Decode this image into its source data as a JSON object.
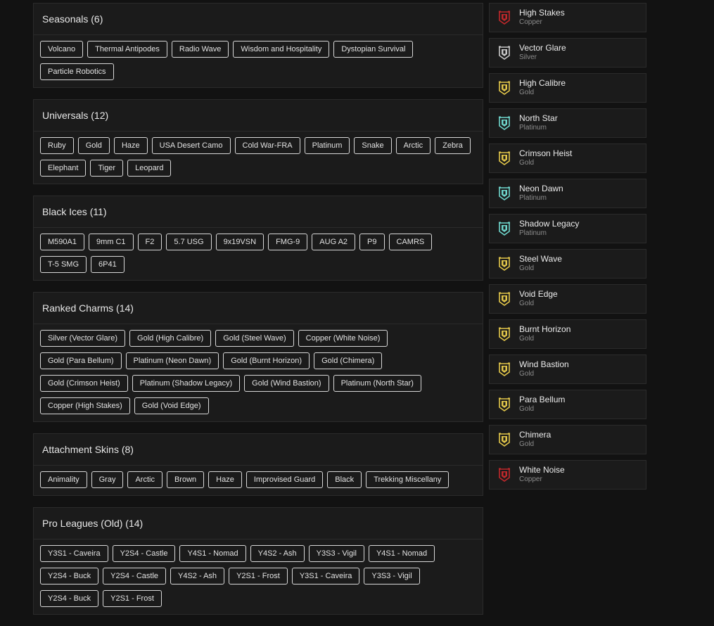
{
  "sections": [
    {
      "title": "Seasonals (6)",
      "items": [
        "Volcano",
        "Thermal Antipodes",
        "Radio Wave",
        "Wisdom and Hospitality",
        "Dystopian Survival",
        "Particle Robotics"
      ]
    },
    {
      "title": "Universals (12)",
      "items": [
        "Ruby",
        "Gold",
        "Haze",
        "USA Desert Camo",
        "Cold War-FRA",
        "Platinum",
        "Snake",
        "Arctic",
        "Zebra",
        "Elephant",
        "Tiger",
        "Leopard"
      ]
    },
    {
      "title": "Black Ices (11)",
      "items": [
        "M590A1",
        "9mm C1",
        "F2",
        "5.7 USG",
        "9x19VSN",
        "FMG-9",
        "AUG A2",
        "P9",
        "CAMRS",
        "T-5 SMG",
        "6P41"
      ]
    },
    {
      "title": "Ranked Charms (14)",
      "items": [
        "Silver (Vector Glare)",
        "Gold (High Calibre)",
        "Gold (Steel Wave)",
        "Copper (White Noise)",
        "Gold (Para Bellum)",
        "Platinum (Neon Dawn)",
        "Gold (Burnt Horizon)",
        "Gold (Chimera)",
        "Gold (Crimson Heist)",
        "Platinum (Shadow Legacy)",
        "Gold (Wind Bastion)",
        "Platinum (North Star)",
        "Copper (High Stakes)",
        "Gold (Void Edge)"
      ]
    },
    {
      "title": "Attachment Skins (8)",
      "items": [
        "Animality",
        "Gray",
        "Arctic",
        "Brown",
        "Haze",
        "Improvised Guard",
        "Black",
        "Trekking Miscellany"
      ]
    },
    {
      "title": "Pro Leagues (Old) (14)",
      "items": [
        "Y3S1 - Caveira",
        "Y2S4 - Castle",
        "Y4S1 - Nomad",
        "Y4S2 - Ash",
        "Y3S3 - Vigil",
        "Y4S1 - Nomad",
        "Y2S4 - Buck",
        "Y2S4 - Castle",
        "Y4S2 - Ash",
        "Y2S1 - Frost",
        "Y3S1 - Caveira",
        "Y3S3 - Vigil",
        "Y2S4 - Buck",
        "Y2S1 - Frost"
      ]
    }
  ],
  "ranks": [
    {
      "name": "High Stakes",
      "tier": "Copper",
      "color": "#c0282b"
    },
    {
      "name": "Vector Glare",
      "tier": "Silver",
      "color": "#c8c8c8"
    },
    {
      "name": "High Calibre",
      "tier": "Gold",
      "color": "#e2c64a"
    },
    {
      "name": "North Star",
      "tier": "Platinum",
      "color": "#6fd6cc"
    },
    {
      "name": "Crimson Heist",
      "tier": "Gold",
      "color": "#e2c64a"
    },
    {
      "name": "Neon Dawn",
      "tier": "Platinum",
      "color": "#6fd6cc"
    },
    {
      "name": "Shadow Legacy",
      "tier": "Platinum",
      "color": "#6fd6cc"
    },
    {
      "name": "Steel Wave",
      "tier": "Gold",
      "color": "#e2c64a"
    },
    {
      "name": "Void Edge",
      "tier": "Gold",
      "color": "#e2c64a"
    },
    {
      "name": "Burnt Horizon",
      "tier": "Gold",
      "color": "#e2c64a"
    },
    {
      "name": "Wind Bastion",
      "tier": "Gold",
      "color": "#e2c64a"
    },
    {
      "name": "Para Bellum",
      "tier": "Gold",
      "color": "#e2c64a"
    },
    {
      "name": "Chimera",
      "tier": "Gold",
      "color": "#e2c64a"
    },
    {
      "name": "White Noise",
      "tier": "Copper",
      "color": "#c0282b"
    }
  ]
}
